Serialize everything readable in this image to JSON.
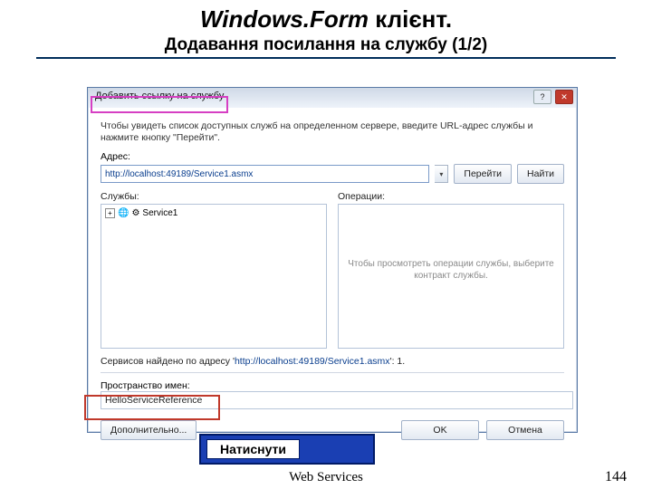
{
  "slide": {
    "title_italic": "Windows.Form",
    "title_rest": " клієнт.",
    "subtitle": "Додавання посилання на службу (1/2)",
    "footer": "Web Services",
    "page_number": "144",
    "callout": "Натиснути"
  },
  "dialog": {
    "title": "Добавить ссылку на службу",
    "help_icon": "?",
    "close_icon": "✕",
    "instruction": "Чтобы увидеть список доступных служб на определенном сервере, введите URL-адрес службы и нажмите кнопку \"Перейти\".",
    "address_label": "Адрес:",
    "address_value": "http://localhost:49189/Service1.asmx",
    "go_button": "Перейти",
    "find_button": "Найти",
    "services_header": "Службы:",
    "operations_header": "Операции:",
    "tree_expand": "+",
    "tree_item": "Service1",
    "operations_placeholder": "Чтобы просмотреть операции службы, выберите контракт службы.",
    "found_prefix": "Сервисов найдено по адресу '",
    "found_url": "http://localhost:49189/Service1.asmx",
    "found_suffix": "': 1.",
    "namespace_label": "Пространство имен:",
    "namespace_value": "HelloServiceReference",
    "advanced_button": "Дополнительно...",
    "ok_button": "OK",
    "cancel_button": "Отмена"
  }
}
